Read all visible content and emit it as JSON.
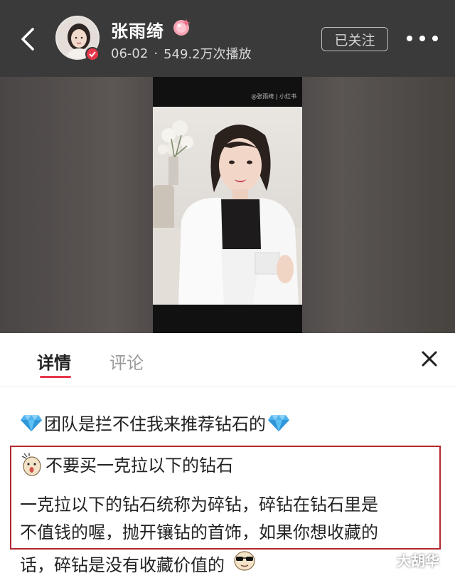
{
  "header": {
    "back_icon": "chevron-left-icon",
    "user_name": "张雨绮",
    "name_badge_icon": "pink-gem-icon",
    "date": "06-02",
    "separator": "·",
    "play_count": "549.2万次播放",
    "follow_label": "已关注",
    "more_icon": "more-dots-icon"
  },
  "video": {
    "watermark": "@张雨绮 | 小红书"
  },
  "tabs": {
    "details": "详情",
    "comments": "评论",
    "close_icon": "close-icon"
  },
  "post": {
    "title": "团队是拦不住我来推荐钻石的",
    "subhead": "不要买一克拉以下的钻石",
    "body_lines": [
      "一克拉以下的钻石统称为碎钻，碎钻在钻石里是",
      "不值钱的喔，抛开镶钻的首饰，如果你想收藏的",
      "话，碎钻是没有收藏价值的"
    ]
  },
  "overlay": {
    "watermark": "大胡华"
  },
  "colors": {
    "header_bg": "#3a3a3a",
    "accent": "#e8374a",
    "highlight_border": "#b2282e"
  }
}
